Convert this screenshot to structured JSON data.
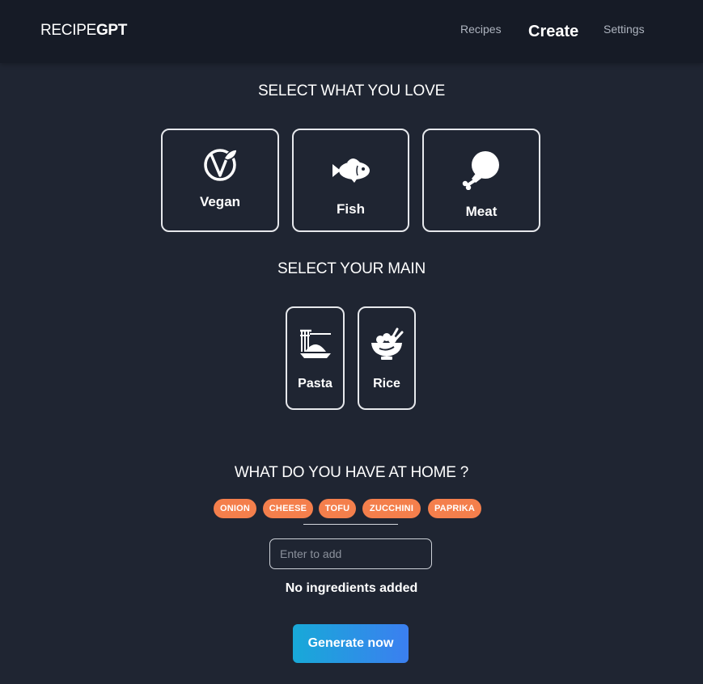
{
  "header": {
    "logo_light": "RECIPE",
    "logo_bold": "GPT",
    "nav": {
      "recipes": "Recipes",
      "create": "Create",
      "settings": "Settings"
    }
  },
  "preferences": {
    "title": "SELECT WHAT YOU LOVE",
    "options": [
      {
        "label": "Vegan",
        "icon": "vegan-icon"
      },
      {
        "label": "Fish",
        "icon": "fish-icon"
      },
      {
        "label": "Meat",
        "icon": "drumstick-icon"
      }
    ]
  },
  "mains": {
    "title": "SELECT YOUR MAIN",
    "options": [
      {
        "label": "Pasta",
        "icon": "pasta-icon"
      },
      {
        "label": "Rice",
        "icon": "rice-bowl-icon"
      }
    ]
  },
  "ingredients": {
    "title": "WHAT DO YOU HAVE AT HOME ?",
    "suggestions": [
      "ONION",
      "CHEESE",
      "TOFU",
      "ZUCCHINI",
      "PAPRIKA"
    ],
    "input_placeholder": "Enter to add",
    "input_value": "",
    "empty_message": "No ingredients added"
  },
  "actions": {
    "generate_label": "Generate now"
  },
  "colors": {
    "background": "#1f2532",
    "header": "#161b26",
    "chip": "#f47f4c",
    "button_gradient_start": "#18a9d8",
    "button_gradient_end": "#3b7ff0"
  }
}
